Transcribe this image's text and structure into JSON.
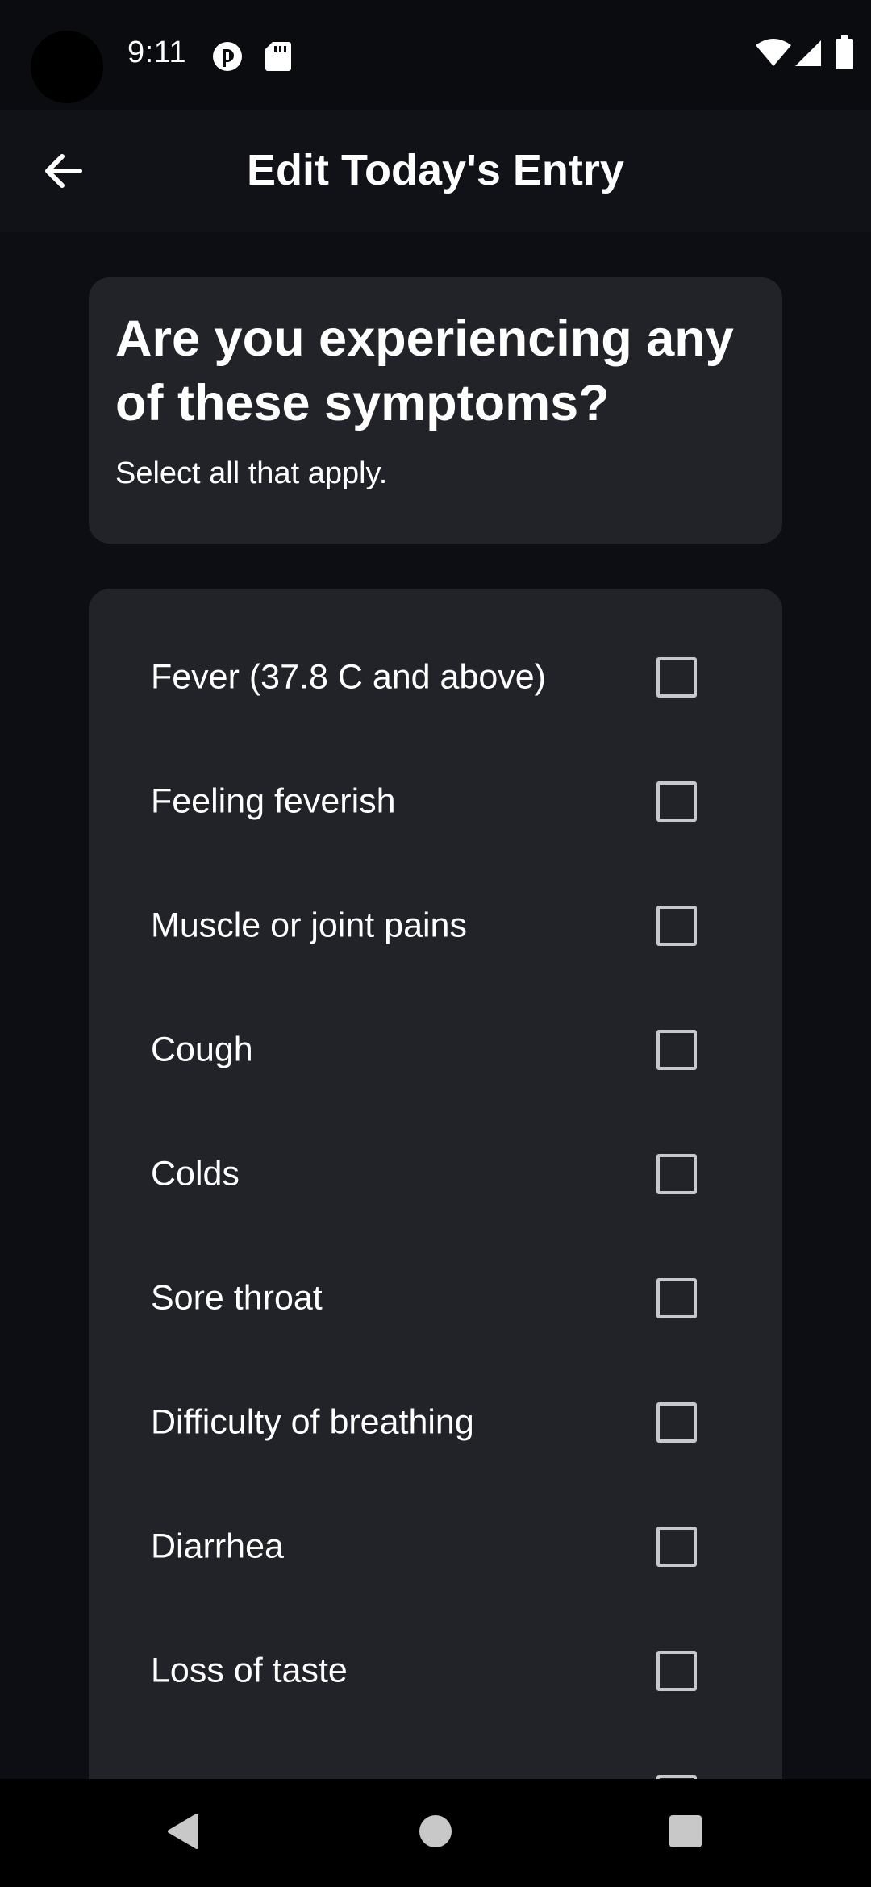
{
  "status_bar": {
    "time": "9:11",
    "left_icons": [
      "sync-icon",
      "sd-card-icon"
    ],
    "right_icons": [
      "wifi-icon",
      "signal-icon",
      "battery-icon"
    ]
  },
  "app_bar": {
    "title": "Edit Today's Entry",
    "back_icon": "arrow-left-icon"
  },
  "question": {
    "title": "Are you experiencing any of these symptoms?",
    "subtitle": "Select all that apply."
  },
  "symptoms": [
    {
      "label": "Fever (37.8 C and above)",
      "checked": false
    },
    {
      "label": "Feeling feverish",
      "checked": false
    },
    {
      "label": "Muscle or joint pains",
      "checked": false
    },
    {
      "label": "Cough",
      "checked": false
    },
    {
      "label": "Colds",
      "checked": false
    },
    {
      "label": "Sore throat",
      "checked": false
    },
    {
      "label": "Difficulty of breathing",
      "checked": false
    },
    {
      "label": "Diarrhea",
      "checked": false
    },
    {
      "label": "Loss of taste",
      "checked": false
    }
  ],
  "nav_bar": {
    "buttons": [
      "back-triangle-icon",
      "home-circle-icon",
      "recents-square-icon"
    ]
  },
  "colors": {
    "background": "#0c0e13",
    "card": "#222329",
    "app_bar": "#101218",
    "checkbox_border": "#c7c8cc"
  }
}
